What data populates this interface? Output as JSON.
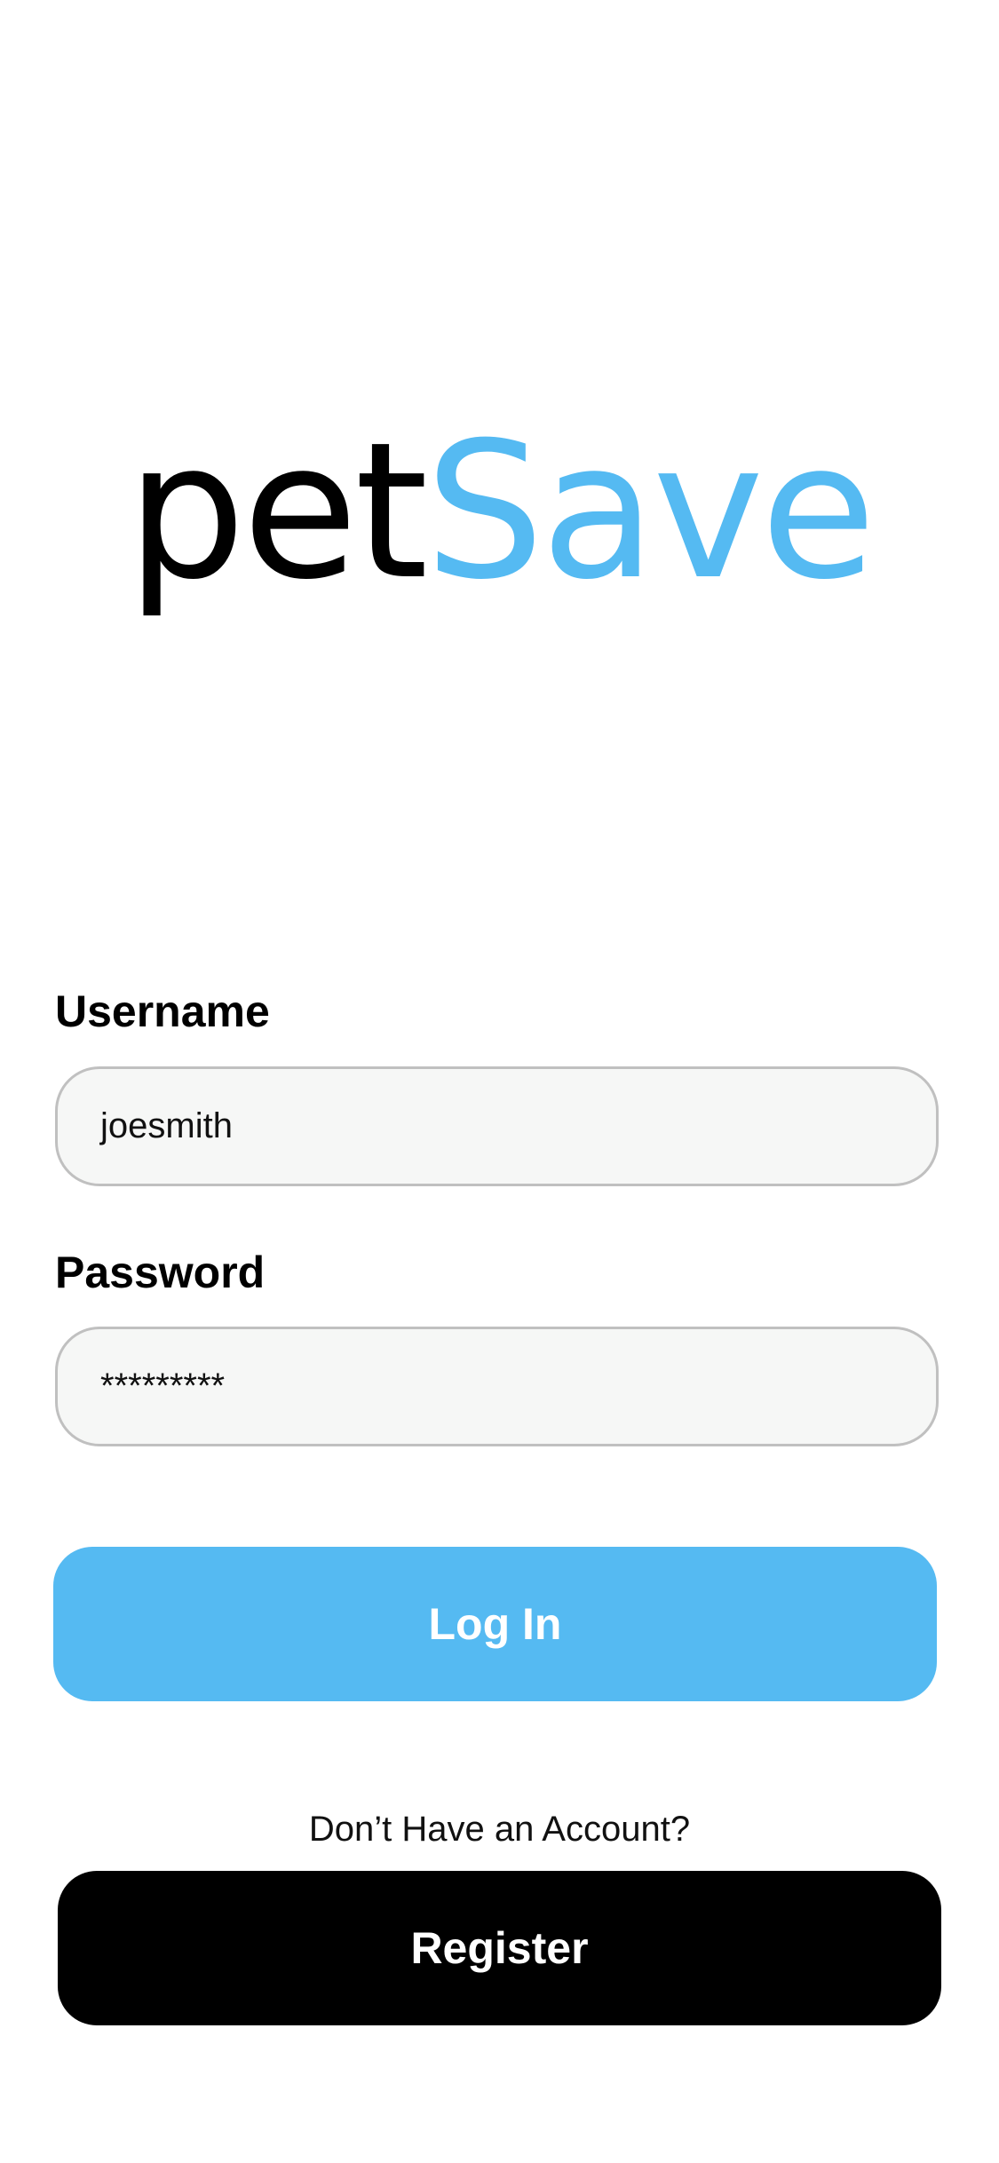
{
  "logo": {
    "part1": "pet",
    "part2": "Save",
    "colors": {
      "part1": "#000000",
      "part2": "#55baf2"
    }
  },
  "form": {
    "username_label": "Username",
    "username_value": "joesmith",
    "password_label": "Password",
    "password_value": "*********"
  },
  "actions": {
    "login_label": "Log In",
    "register_prompt": "Don’t Have an Account?",
    "register_label": "Register"
  },
  "theme": {
    "accent": "#55baf2",
    "input_background": "#f6f7f6",
    "input_border": "#c0c0c0",
    "register_background": "#000000"
  }
}
